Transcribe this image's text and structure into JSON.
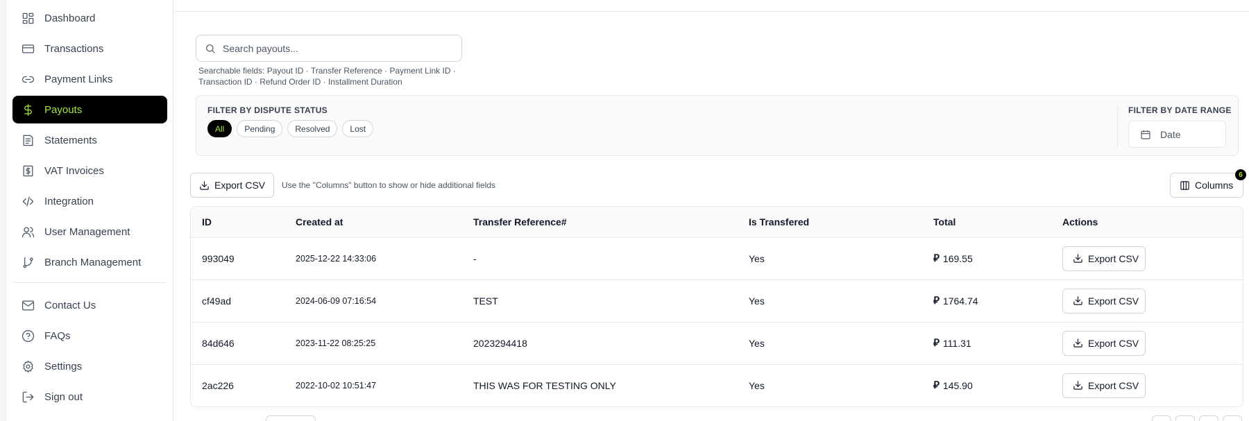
{
  "sidebar": {
    "items": [
      {
        "label": "Dashboard",
        "icon": "dashboard-icon"
      },
      {
        "label": "Transactions",
        "icon": "credit-card-icon"
      },
      {
        "label": "Payment Links",
        "icon": "link-icon"
      },
      {
        "label": "Payouts",
        "icon": "dollar-icon",
        "active": true
      },
      {
        "label": "Statements",
        "icon": "document-icon"
      },
      {
        "label": "VAT Invoices",
        "icon": "invoice-icon"
      },
      {
        "label": "Integration",
        "icon": "code-icon"
      },
      {
        "label": "User Management",
        "icon": "users-icon"
      },
      {
        "label": "Branch Management",
        "icon": "branch-icon"
      }
    ],
    "footer_items": [
      {
        "label": "Contact Us",
        "icon": "mail-icon"
      },
      {
        "label": "FAQs",
        "icon": "help-icon"
      },
      {
        "label": "Settings",
        "icon": "gear-icon"
      },
      {
        "label": "Sign out",
        "icon": "sign-out-icon"
      }
    ]
  },
  "search": {
    "placeholder": "Search payouts...",
    "hint": "Searchable fields: Payout ID · Transfer Reference · Payment Link ID · Transaction ID · Refund Order ID · Installment Duration"
  },
  "filters": {
    "dispute_title": "FILTER BY DISPUTE STATUS",
    "dispute_options": [
      "All",
      "Pending",
      "Resolved",
      "Lost"
    ],
    "selected_dispute": "All",
    "date_title": "FILTER BY DATE RANGE",
    "date_label": "Date"
  },
  "toolbar": {
    "export_label": "Export CSV",
    "columns_hint": "Use the \"Columns\" button to show or hide additional fields",
    "columns_label": "Columns",
    "columns_count": "6"
  },
  "table": {
    "headers": [
      "ID",
      "Created at",
      "Transfer Reference#",
      "Is Transfered",
      "Total",
      "Actions"
    ],
    "currency_symbol": "⃁",
    "action_label": "Export CSV",
    "rows": [
      {
        "id": "993049",
        "created_at": "2025-12-22 14:33:06",
        "transfer_reference": "-",
        "is_transfered": "Yes",
        "total": "169.55"
      },
      {
        "id": "cf49ad",
        "created_at": "2024-06-09 07:16:54",
        "transfer_reference": "TEST",
        "is_transfered": "Yes",
        "total": "1764.74"
      },
      {
        "id": "84d646",
        "created_at": "2023-11-22 08:25:25",
        "transfer_reference": "2023294418",
        "is_transfered": "Yes",
        "total": "111.31"
      },
      {
        "id": "2ac226",
        "created_at": "2022-10-02 10:51:47",
        "transfer_reference": "THIS WAS FOR TESTING ONLY",
        "is_transfered": "Yes",
        "total": "145.90"
      }
    ]
  },
  "colors": {
    "accent": "#a3e635",
    "active_bg": "#000000"
  }
}
